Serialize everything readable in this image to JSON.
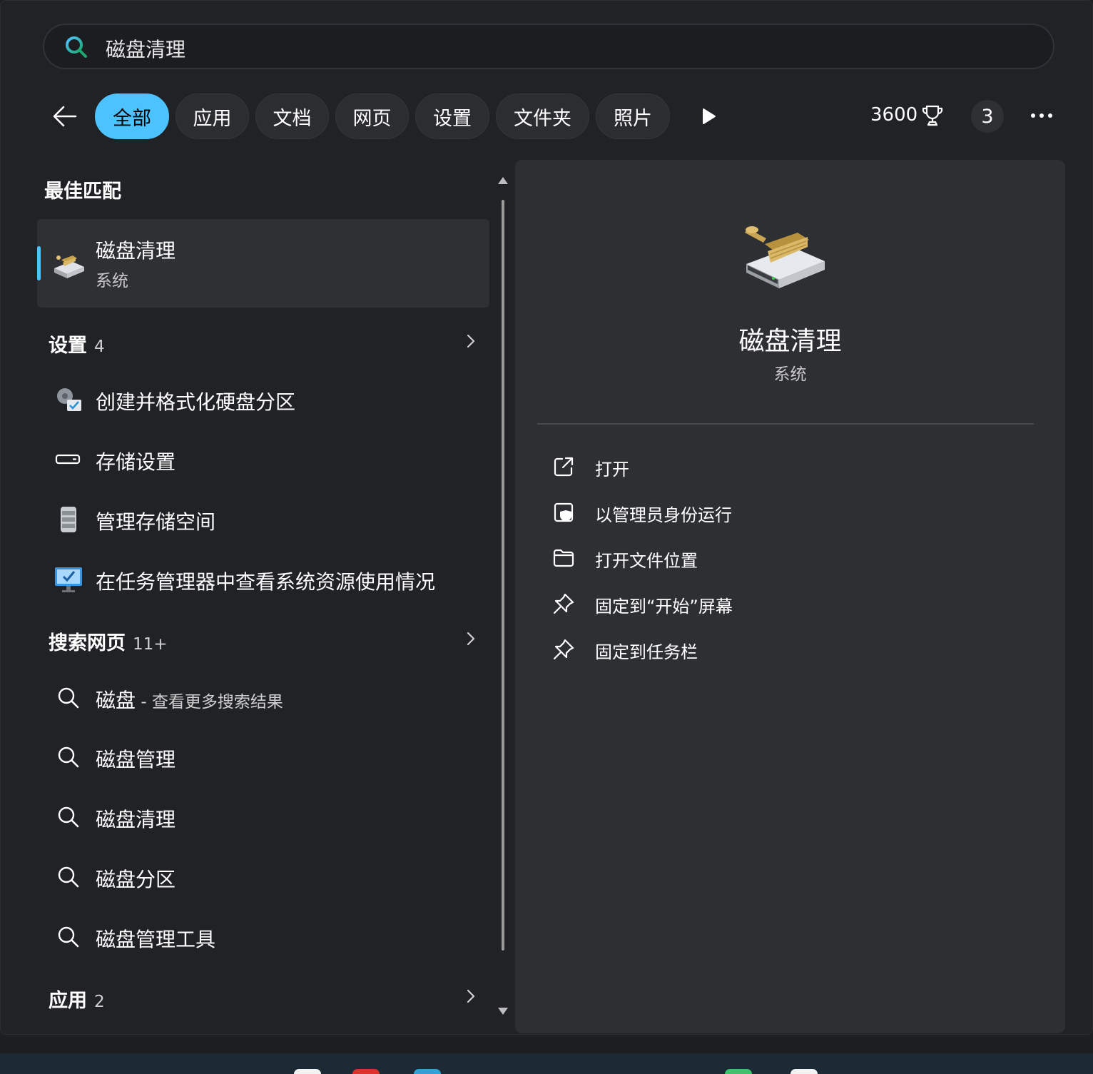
{
  "search": {
    "query": "磁盘清理"
  },
  "filters": [
    "全部",
    "应用",
    "文档",
    "网页",
    "设置",
    "文件夹",
    "照片"
  ],
  "header": {
    "points": "3600",
    "badge_count": "3"
  },
  "best_match": {
    "title": "最佳匹配",
    "item": {
      "name": "磁盘清理",
      "type": "系统"
    }
  },
  "settings_section": {
    "title": "设置",
    "count": "4",
    "items": [
      {
        "label": "创建并格式化硬盘分区",
        "icon": "partition-icon"
      },
      {
        "label": "存储设置",
        "icon": "storage-icon"
      },
      {
        "label": "管理存储空间",
        "icon": "storage-spaces-icon"
      },
      {
        "label": "在任务管理器中查看系统资源使用情况",
        "icon": "task-manager-icon"
      }
    ]
  },
  "web_section": {
    "title": "搜索网页",
    "count": "11+",
    "first": {
      "query": "磁盘",
      "suffix": " - 查看更多搜索结果"
    },
    "items": [
      "磁盘管理",
      "磁盘清理",
      "磁盘分区",
      "磁盘管理工具"
    ]
  },
  "apps_section": {
    "title": "应用",
    "count": "2"
  },
  "detail": {
    "title": "磁盘清理",
    "subtitle": "系统",
    "actions": [
      {
        "label": "打开",
        "icon": "open-external-icon"
      },
      {
        "label": "以管理员身份运行",
        "icon": "admin-shield-icon"
      },
      {
        "label": "打开文件位置",
        "icon": "folder-icon"
      },
      {
        "label": "固定到“开始”屏幕",
        "icon": "pin-icon"
      },
      {
        "label": "固定到任务栏",
        "icon": "pin-icon"
      }
    ]
  },
  "colors": {
    "accent": "#4cc2ff",
    "panel": "#202225",
    "detail": "#2d2f32"
  }
}
